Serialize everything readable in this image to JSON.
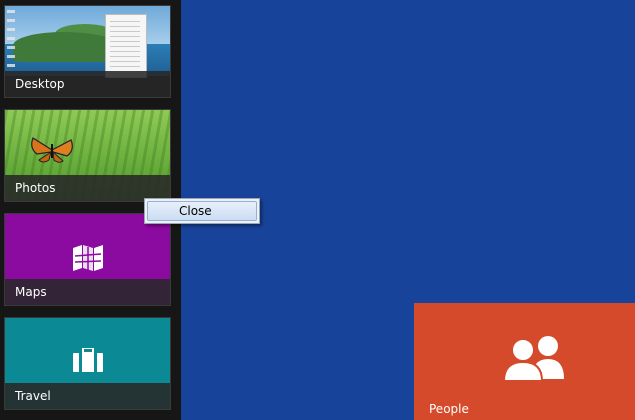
{
  "switcher": {
    "items": [
      {
        "label": "Desktop"
      },
      {
        "label": "Photos"
      },
      {
        "label": "Maps"
      },
      {
        "label": "Travel"
      }
    ]
  },
  "context_menu": {
    "items": [
      {
        "label": "Close"
      }
    ]
  },
  "start_tiles": {
    "people": {
      "label": "People",
      "color": "#d54a2a"
    }
  },
  "colors": {
    "background": "#18439b",
    "maps_tile": "#8b0aa0",
    "travel_tile": "#0b8a96",
    "switcher_bg": "#161616"
  },
  "icons": [
    "map-icon",
    "suitcase-icon",
    "people-icon"
  ]
}
